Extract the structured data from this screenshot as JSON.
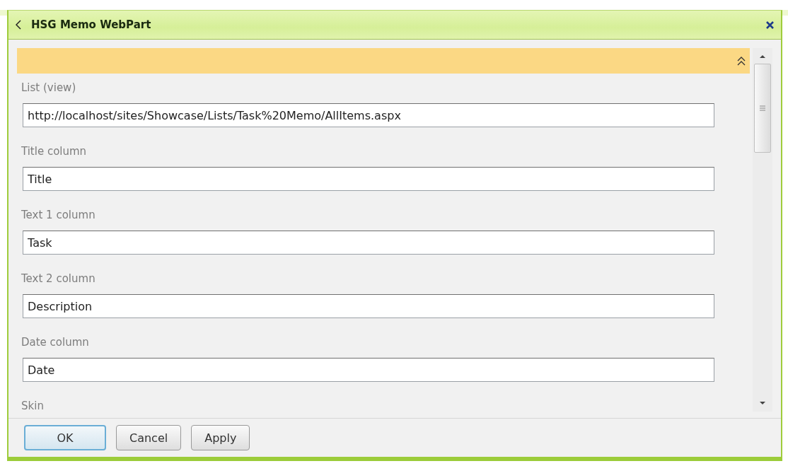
{
  "window": {
    "title": "HSG Memo WebPart"
  },
  "fields": [
    {
      "label": "List (view)",
      "value": "http://localhost/sites/Showcase/Lists/Task%20Memo/AllItems.aspx"
    },
    {
      "label": "Title column",
      "value": "Title"
    },
    {
      "label": "Text 1 column",
      "value": "Task"
    },
    {
      "label": "Text 2 column",
      "value": "Description"
    },
    {
      "label": "Date column",
      "value": "Date"
    },
    {
      "label": "Skin"
    }
  ],
  "buttons": [
    {
      "label": "OK",
      "focused": true
    },
    {
      "label": "Cancel",
      "focused": false
    },
    {
      "label": "Apply",
      "focused": false
    }
  ]
}
